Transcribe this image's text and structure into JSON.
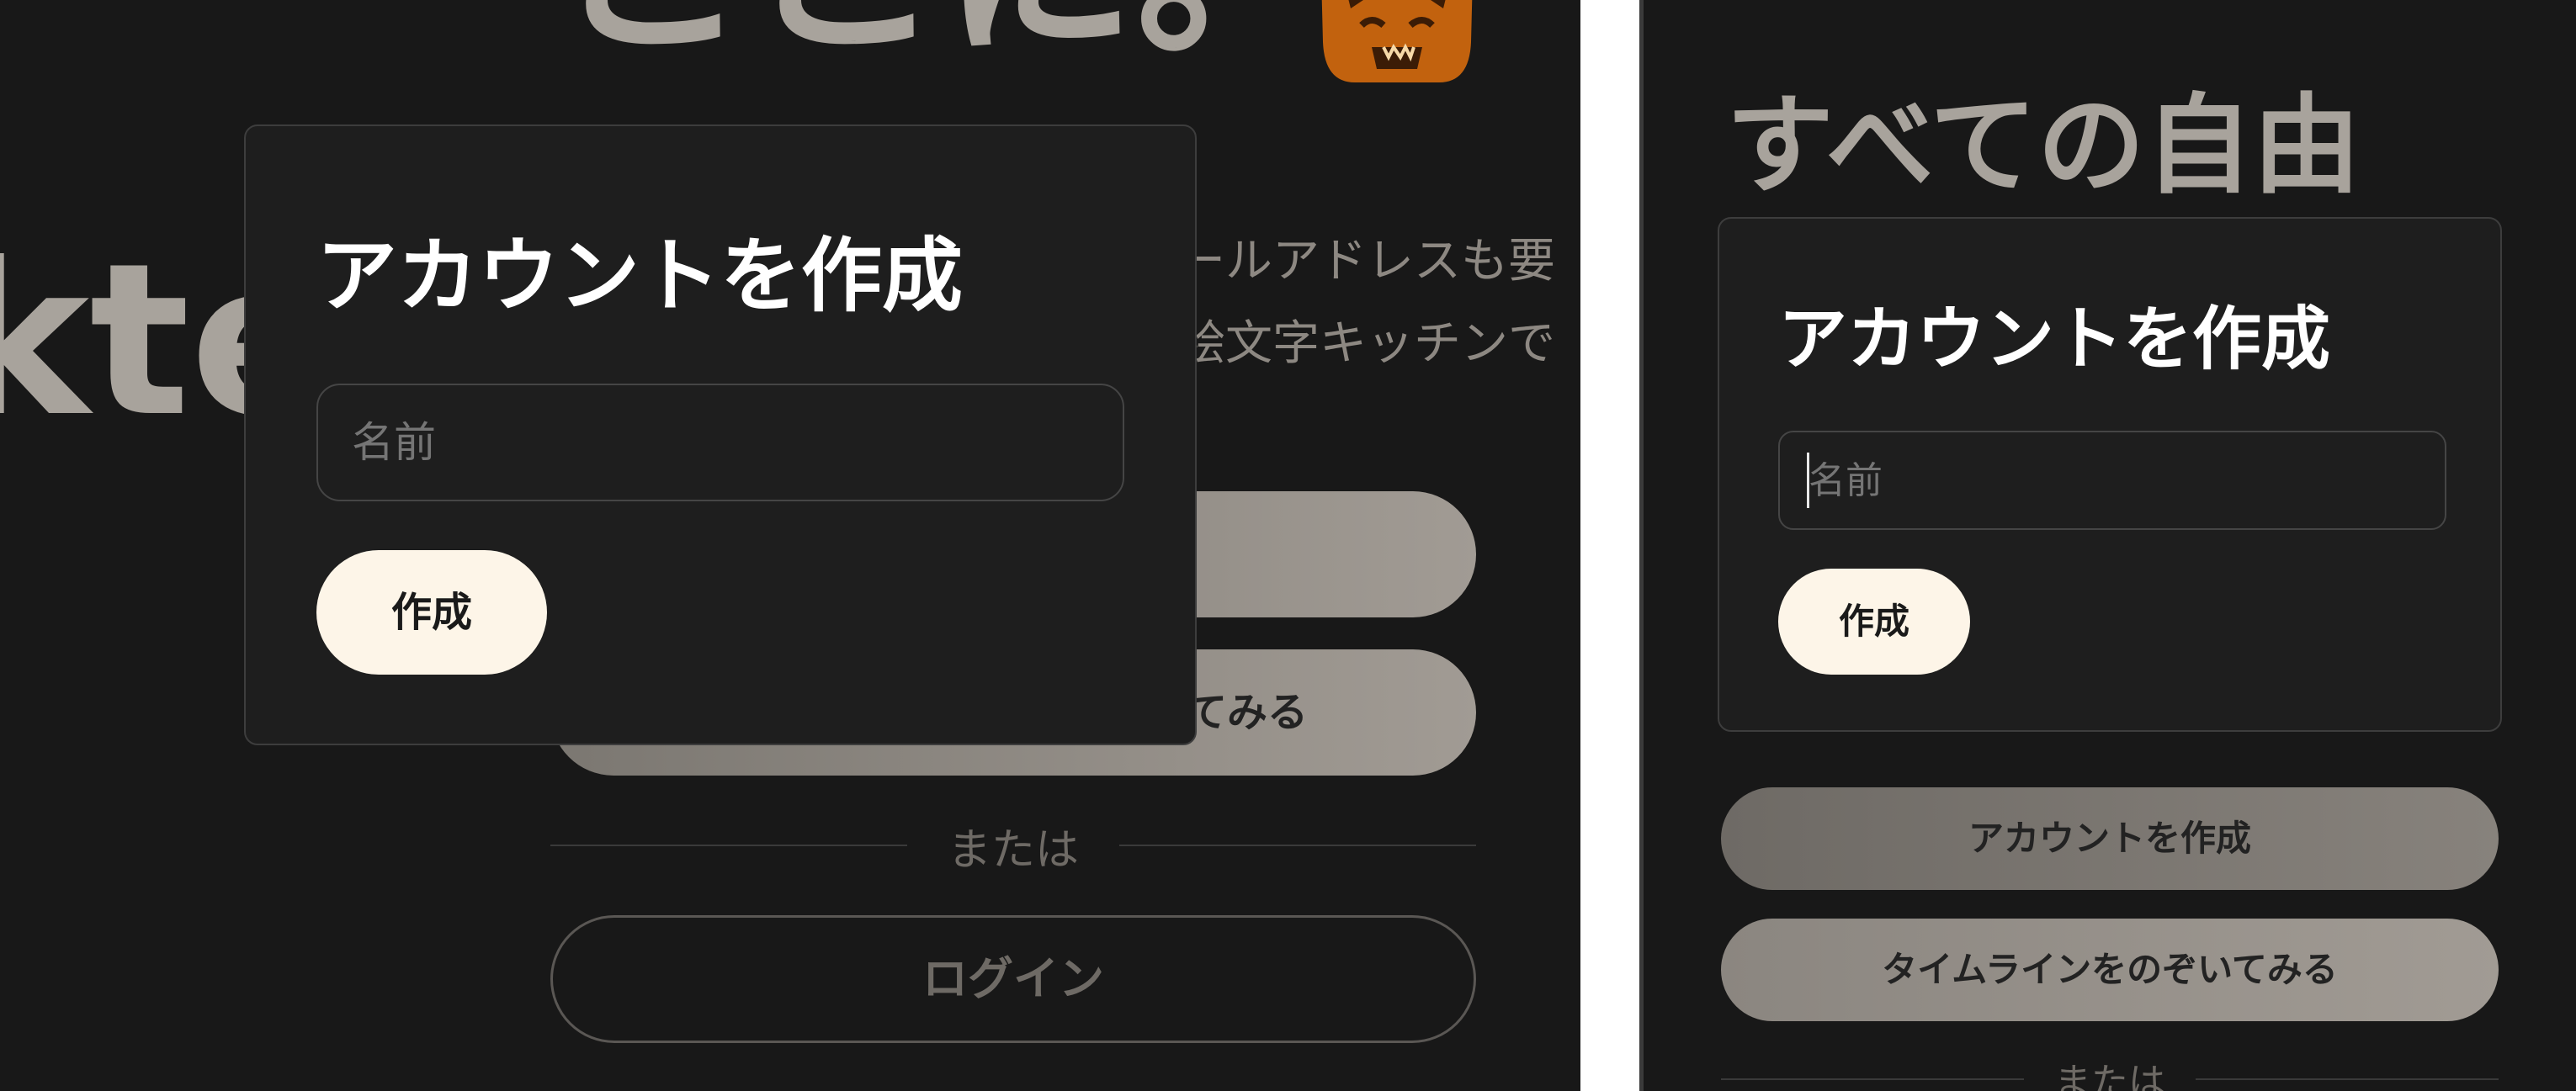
{
  "left_pane": {
    "hero_heading_fragment": "ここに。",
    "hero_side_fragment": "kte",
    "description_line_1": "ールアドレスも要",
    "description_line_2": "絵文字キッチンで",
    "background_buttons": {
      "create_label": "",
      "peek_label_visible_part": "てみる",
      "or_label": "または",
      "login_label": "ログイン"
    },
    "modal": {
      "title": "アカウントを作成",
      "name_placeholder": "名前",
      "name_value": "",
      "create_button_label": "作成"
    }
  },
  "right_pane": {
    "hero_heading": "すべての自由",
    "modal": {
      "title": "アカウントを作成",
      "name_placeholder": "名前",
      "name_value": "",
      "create_button_label": "作成"
    },
    "background_buttons": {
      "create_account_label": "アカウントを作成",
      "peek_timeline_label": "タイムラインをのぞいてみる",
      "or_label": "または"
    }
  },
  "icons": {
    "tiger": "tiger-emoji-icon"
  },
  "colors": {
    "background": "#181818",
    "modal_background": "#1e1e1e",
    "modal_border": "#3d3d3d",
    "primary_button": "#fdf5e8",
    "hero_text": "#a8a39c",
    "tiger_orange": "#c2620e"
  }
}
